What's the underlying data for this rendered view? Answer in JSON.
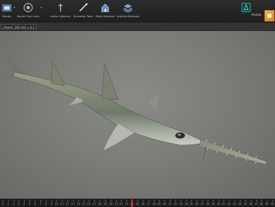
{
  "toolbar": {
    "tools": [
      {
        "name": "render-button",
        "label": "Render",
        "icon": "render-icon"
      },
      {
        "name": "render-from-view-button",
        "label": "Render From View",
        "icon": "camera-icon"
      },
      {
        "name": "author-selection-button",
        "label": "Author Selection",
        "icon": "pin-icon"
      },
      {
        "name": "animation-tools-button",
        "label": "Animation Tools",
        "icon": "wand-icon"
      },
      {
        "name": "block-materials-button",
        "label": "Block Materials",
        "icon": "house-icon"
      },
      {
        "name": "selected-materials-button",
        "label": "Selected Materials",
        "icon": "layers-icon"
      }
    ],
    "right_label": "Models",
    "accent": "#f0a23a"
  },
  "options": {
    "items": [
      "Character",
      "100 Units",
      "x 0.5"
    ]
  },
  "timeline": {
    "frames": [
      "0",
      "1",
      "2",
      "3",
      "4",
      "5",
      "6",
      "7",
      "8",
      "9",
      "10",
      "11",
      "12",
      "13",
      "14",
      "15",
      "16",
      "17",
      "18",
      "19",
      "20",
      "21",
      "22",
      "23",
      "24",
      "25",
      "26",
      "27",
      "28",
      "29",
      "30",
      "31",
      "32",
      "33",
      "34",
      "35",
      "36",
      "37",
      "38",
      "39",
      "40",
      "41",
      "42",
      "43",
      "44",
      "45",
      "46",
      "47",
      "48",
      "49",
      "50"
    ],
    "current_frame": 24,
    "playhead_color": "#e03030"
  }
}
